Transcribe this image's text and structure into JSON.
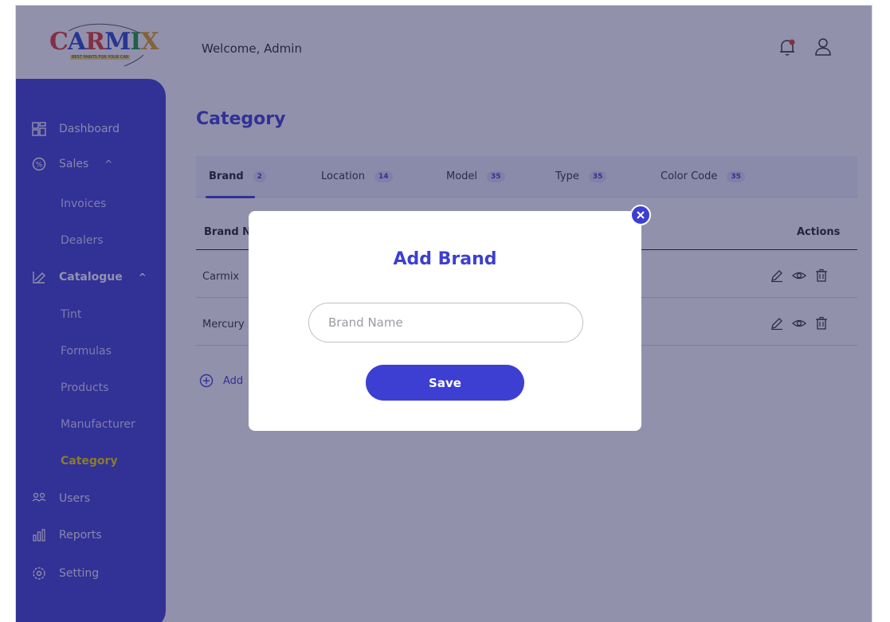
{
  "header": {
    "logo_text": "CARMIX",
    "logo_tagline": "BEST PAINTS FOR YOUR CAR",
    "welcome": "Welcome, Admin",
    "icons": [
      "bell-icon",
      "user-icon"
    ]
  },
  "sidebar": {
    "items": [
      {
        "label": "Dashboard",
        "icon": "dashboard-icon"
      },
      {
        "label": "Sales",
        "icon": "sales-icon",
        "caret": "^"
      },
      {
        "label": "Invoices"
      },
      {
        "label": "Dealers"
      },
      {
        "label": "Catalogue",
        "icon": "catalogue-icon",
        "caret": "^"
      },
      {
        "label": "Tint"
      },
      {
        "label": "Formulas"
      },
      {
        "label": "Products"
      },
      {
        "label": "Manufacturer"
      },
      {
        "label": "Category",
        "active": true
      },
      {
        "label": "Users",
        "icon": "users-icon"
      },
      {
        "label": "Reports",
        "icon": "reports-icon"
      },
      {
        "label": "Setting",
        "icon": "settings-icon"
      }
    ],
    "active_color": "#f2d200"
  },
  "main": {
    "title": "Category",
    "tabs": [
      {
        "label": "Brand",
        "count": "2"
      },
      {
        "label": "Location",
        "count": "14"
      },
      {
        "label": "Model",
        "count": "35"
      },
      {
        "label": "Type",
        "count": "35"
      },
      {
        "label": "Color Code",
        "count": "35"
      }
    ],
    "table": {
      "headers": [
        "Brand N",
        "Actions"
      ],
      "rows": [
        {
          "name": "Carmix"
        },
        {
          "name": "Mercury"
        }
      ]
    },
    "add_label": "Add"
  },
  "modal": {
    "title": "Add Brand",
    "input_placeholder": "Brand Name",
    "input_value": "",
    "save_label": "Save"
  },
  "colors": {
    "primary": "#3d3fd2",
    "accent": "#f2d200",
    "logo_red": "#e23a2f",
    "logo_blue": "#2b49c9"
  }
}
